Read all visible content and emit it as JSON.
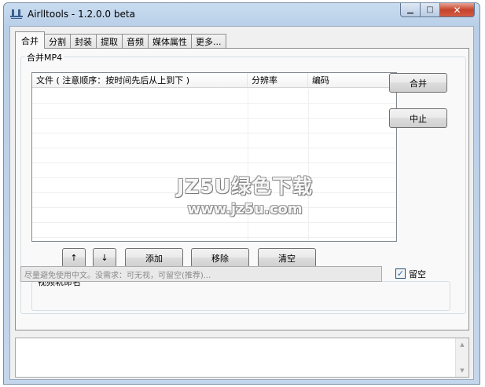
{
  "window": {
    "title": "Airlltools  -  1.2.0.0 beta",
    "controls": {
      "minimize": "▁",
      "maximize": "□",
      "close": "✕"
    }
  },
  "tabs": [
    {
      "label": "合并",
      "active": true
    },
    {
      "label": "分割",
      "active": false
    },
    {
      "label": "封装",
      "active": false
    },
    {
      "label": "提取",
      "active": false
    },
    {
      "label": "音频",
      "active": false
    },
    {
      "label": "媒体属性",
      "active": false
    },
    {
      "label": "更多...",
      "active": false
    }
  ],
  "merge_group": {
    "label": "合并MP4",
    "columns": [
      "文件 ( 注意顺序：按时间先后从上到下 )",
      "分辨率",
      "编码"
    ]
  },
  "side_buttons": {
    "merge": "合并",
    "abort": "中止"
  },
  "list_buttons": {
    "up": "↑",
    "down": "↓",
    "add": "添加",
    "remove": "移除",
    "clear": "清空"
  },
  "track_group": {
    "label": "视频轨命名",
    "input_placeholder": "尽量避免使用中文。没需求：可无视，可留空(推荐)...",
    "checkbox_label": "留空",
    "checkbox_checked": true
  },
  "watermark": {
    "line1": "JZ5U绿色下载",
    "line2": "www.jz5u.com"
  },
  "colors": {
    "accent": "#2a6cb8",
    "close_button": "#c7432c"
  }
}
